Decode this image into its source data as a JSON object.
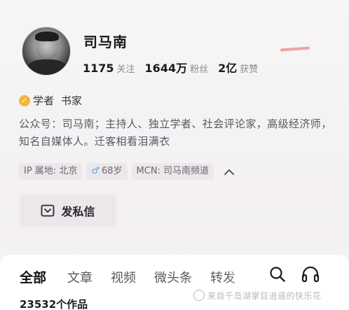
{
  "profile": {
    "name": "司马南",
    "stats": [
      {
        "value": "1175",
        "label": "关注"
      },
      {
        "value": "1644万",
        "label": "粉丝"
      },
      {
        "value": "2亿",
        "label": "获赞"
      }
    ],
    "verify_badge": "✓",
    "verify_titles": [
      "学者",
      "书家"
    ],
    "bio": "公众号：司马南；主持人、独立学者、社会评论家，高级经济师，知名自媒体人。迁客相看泪满衣"
  },
  "tags": {
    "ip": "IP 属地: 北京",
    "gender_icon": "♂",
    "age": "68岁",
    "mcn": "MCN: 司马南频道"
  },
  "actions": {
    "message_label": "发私信"
  },
  "tabs": {
    "items": [
      "全部",
      "文章",
      "视频",
      "微头条",
      "转发"
    ]
  },
  "works_count": "23532个作品",
  "watermark": "来自千岛湖掌目逍遥的快乐花",
  "colors": {
    "accent_gold": "#f2b53a",
    "gender_blue": "#5aa3e6"
  },
  "icons": [
    "chevron-up-icon",
    "message-icon",
    "search-icon",
    "headphones-icon"
  ]
}
